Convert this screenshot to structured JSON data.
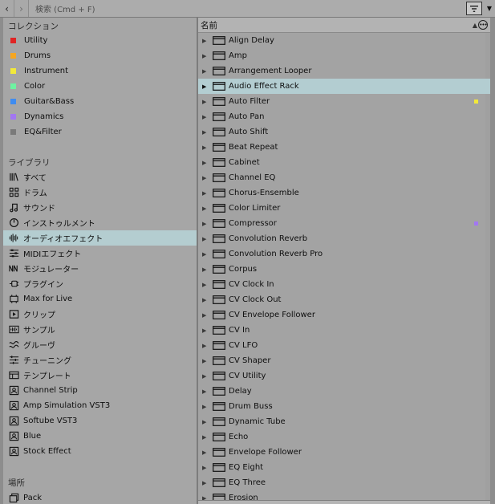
{
  "topbar": {
    "back_icon": "chevron-left-icon",
    "forward_icon": "chevron-right-icon",
    "search_placeholder": "検索 (Cmd + F)",
    "filter_icon": "filter-icon",
    "menu_icon": "chevron-down-icon"
  },
  "sidebar": {
    "collections_title": "コレクション",
    "collections": [
      {
        "label": "Utility",
        "color": "#e02424"
      },
      {
        "label": "Drums",
        "color": "#f5a623"
      },
      {
        "label": "Instrument",
        "color": "#f2e93a"
      },
      {
        "label": "Color",
        "color": "#6ef2a1"
      },
      {
        "label": "Guitar&Bass",
        "color": "#3f8cf0"
      },
      {
        "label": "Dynamics",
        "color": "#a277f2"
      },
      {
        "label": "EQ&Filter",
        "color": "#7a7a7a"
      }
    ],
    "library_title": "ライブラリ",
    "library": [
      {
        "label": "すべて",
        "icon": "all-icon"
      },
      {
        "label": "ドラム",
        "icon": "drum-grid-icon"
      },
      {
        "label": "サウンド",
        "icon": "music-note-icon"
      },
      {
        "label": "インストゥルメント",
        "icon": "instrument-knob-icon"
      },
      {
        "label": "オーディオエフェクト",
        "icon": "audio-effect-icon",
        "selected": true
      },
      {
        "label": "MIDIエフェクト",
        "icon": "midi-effect-icon"
      },
      {
        "label": "モジュレーター",
        "icon": "modulator-icon"
      },
      {
        "label": "プラグイン",
        "icon": "plugin-icon"
      },
      {
        "label": "Max for Live",
        "icon": "max-for-live-icon"
      },
      {
        "label": "クリップ",
        "icon": "clip-icon"
      },
      {
        "label": "サンプル",
        "icon": "sample-icon"
      },
      {
        "label": "グルーヴ",
        "icon": "groove-icon"
      },
      {
        "label": "チューニング",
        "icon": "tuning-icon"
      },
      {
        "label": "テンプレート",
        "icon": "template-icon"
      },
      {
        "label": "Channel Strip",
        "icon": "user-folder-icon"
      },
      {
        "label": "Amp Simulation VST3",
        "icon": "user-folder-icon"
      },
      {
        "label": "Softube VST3",
        "icon": "user-folder-icon"
      },
      {
        "label": "Blue",
        "icon": "user-folder-icon"
      },
      {
        "label": "Stock Effect",
        "icon": "user-folder-icon"
      }
    ],
    "places_title": "場所",
    "places": [
      {
        "label": "Pack",
        "icon": "pack-icon"
      }
    ]
  },
  "list": {
    "header": "名前",
    "sort_icon": "sort-ascending-icon",
    "options_icon": "more-options-icon",
    "rows": [
      {
        "label": "Align Delay"
      },
      {
        "label": "Amp"
      },
      {
        "label": "Arrangement Looper"
      },
      {
        "label": "Audio Effect Rack",
        "selected": true
      },
      {
        "label": "Auto Filter",
        "tag": "#f2e93a"
      },
      {
        "label": "Auto Pan"
      },
      {
        "label": "Auto Shift"
      },
      {
        "label": "Beat Repeat"
      },
      {
        "label": "Cabinet"
      },
      {
        "label": "Channel EQ"
      },
      {
        "label": "Chorus-Ensemble"
      },
      {
        "label": "Color Limiter"
      },
      {
        "label": "Compressor",
        "tag": "#a277f2"
      },
      {
        "label": "Convolution Reverb"
      },
      {
        "label": "Convolution Reverb Pro"
      },
      {
        "label": "Corpus"
      },
      {
        "label": "CV Clock In"
      },
      {
        "label": "CV Clock Out"
      },
      {
        "label": "CV Envelope Follower"
      },
      {
        "label": "CV In"
      },
      {
        "label": "CV LFO"
      },
      {
        "label": "CV Shaper"
      },
      {
        "label": "CV Utility"
      },
      {
        "label": "Delay"
      },
      {
        "label": "Drum Buss"
      },
      {
        "label": "Dynamic Tube"
      },
      {
        "label": "Echo"
      },
      {
        "label": "Envelope Follower"
      },
      {
        "label": "EQ Eight"
      },
      {
        "label": "EQ Three"
      },
      {
        "label": "Erosion"
      }
    ]
  }
}
